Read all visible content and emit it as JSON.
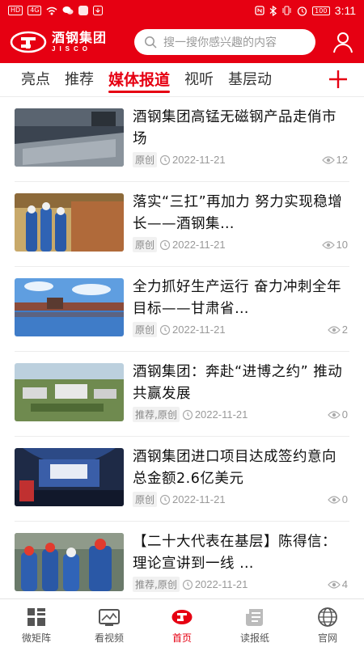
{
  "statusbar": {
    "left_badge_1": "HD",
    "left_badge_2": "4G",
    "time": "3:11",
    "battery": "100"
  },
  "header": {
    "logo_cn": "酒钢集团",
    "logo_en": "JISCO",
    "search_placeholder": "搜一搜你感兴趣的内容"
  },
  "tabs": [
    {
      "label": "亮点"
    },
    {
      "label": "推荐"
    },
    {
      "label": "媒体报道"
    },
    {
      "label": "视听"
    },
    {
      "label": "基层动"
    }
  ],
  "news": [
    {
      "title": "酒钢集团高锰无磁钢产品走俏市场",
      "tag": "原创",
      "date": "2022-11-21",
      "views": "12"
    },
    {
      "title": "落实“三扛”再加力 努力实现稳增长——酒钢集…",
      "tag": "原创",
      "date": "2022-11-21",
      "views": "10"
    },
    {
      "title": "全力抓好生产运行 奋力冲刺全年目标——甘肃省…",
      "tag": "原创",
      "date": "2022-11-21",
      "views": "2"
    },
    {
      "title": "酒钢集团：奔赴“进博之约” 推动共赢发展",
      "tag": "推荐,原创",
      "date": "2022-11-21",
      "views": "0"
    },
    {
      "title": "酒钢集团进口项目达成签约意向 总金额2.6亿美元",
      "tag": "原创",
      "date": "2022-11-21",
      "views": "0"
    },
    {
      "title": "【二十大代表在基层】陈得信：理论宣讲到一线 …",
      "tag": "推荐,原创",
      "date": "2022-11-21",
      "views": "4"
    }
  ],
  "bottom_nav": [
    {
      "label": "微矩阵",
      "icon": "grid-icon"
    },
    {
      "label": "看视频",
      "icon": "video-icon"
    },
    {
      "label": "首页",
      "icon": "home-logo-icon"
    },
    {
      "label": "读报纸",
      "icon": "newspaper-icon"
    },
    {
      "label": "官网",
      "icon": "globe-icon"
    }
  ],
  "colors": {
    "brand": "#e60012",
    "meta": "#999999"
  }
}
